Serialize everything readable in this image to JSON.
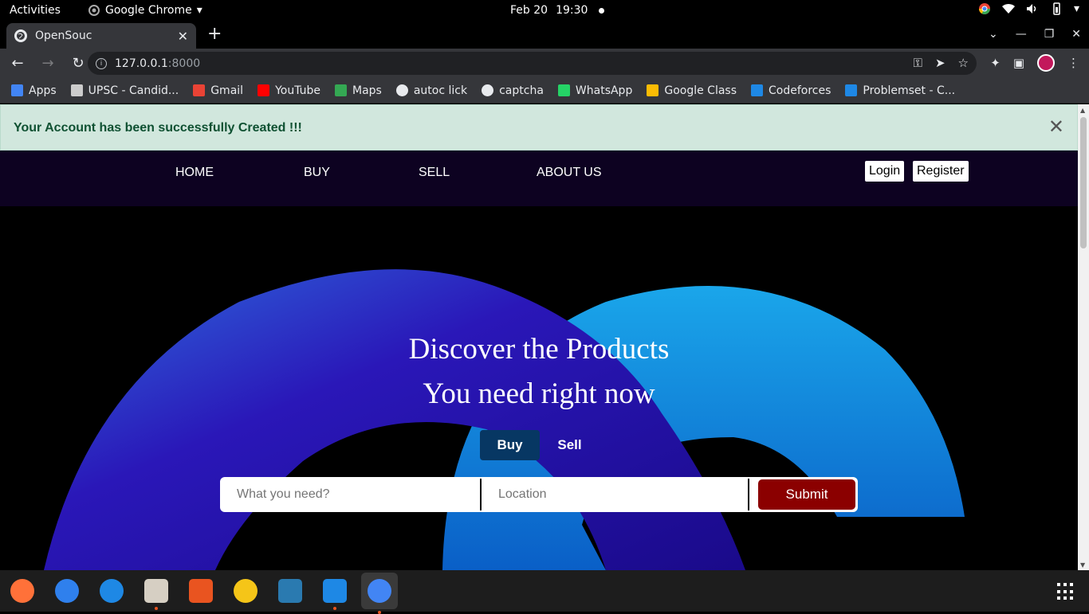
{
  "system": {
    "activities": "Activities",
    "app_name": "Google Chrome",
    "date": "Feb 20",
    "time": "19:30"
  },
  "browser": {
    "tab_title": "OpenSouc",
    "url_host": "127.0.0.1",
    "url_port": ":8000",
    "bookmarks": [
      {
        "label": "Apps",
        "icon": "apps-grid-icon",
        "color": "#4285f4"
      },
      {
        "label": "UPSC - Candid...",
        "icon": "upsc-icon",
        "color": "#cccccc"
      },
      {
        "label": "Gmail",
        "icon": "gmail-icon",
        "color": "#ea4335"
      },
      {
        "label": "YouTube",
        "icon": "youtube-icon",
        "color": "#ff0000"
      },
      {
        "label": "Maps",
        "icon": "maps-icon",
        "color": "#34a853"
      },
      {
        "label": "autoc lick",
        "icon": "globe-icon",
        "color": "#e8eaed"
      },
      {
        "label": "captcha",
        "icon": "globe-icon",
        "color": "#e8eaed"
      },
      {
        "label": "WhatsApp",
        "icon": "whatsapp-icon",
        "color": "#25d366"
      },
      {
        "label": "Google Class",
        "icon": "classroom-icon",
        "color": "#fbbc04"
      },
      {
        "label": "Codeforces",
        "icon": "codeforces-icon",
        "color": "#1e88e5"
      },
      {
        "label": "Problemset - C...",
        "icon": "codeforces-icon",
        "color": "#1e88e5"
      }
    ]
  },
  "page": {
    "alert_text": "Your Account has been successfully Created !!!",
    "nav": {
      "home": "HOME",
      "buy": "BUY",
      "sell": "SELL",
      "about": "ABOUT US",
      "login": "Login",
      "register": "Register"
    },
    "hero": {
      "line1": "Discover the Products",
      "line2": "You need right now"
    },
    "toggle": {
      "buy": "Buy",
      "sell": "Sell",
      "active": "Buy"
    },
    "search": {
      "what_placeholder": "What you need?",
      "location_placeholder": "Location",
      "submit": "Submit"
    }
  },
  "dock": [
    {
      "name": "firefox-icon",
      "color": "#ff7139"
    },
    {
      "name": "thunderbird-icon",
      "color": "#2f80ed"
    },
    {
      "name": "help-icon",
      "color": "#1e88e5"
    },
    {
      "name": "files-icon",
      "color": "#d6cfc3"
    },
    {
      "name": "software-center-icon",
      "color": "#e95420"
    },
    {
      "name": "rhythmbox-icon",
      "color": "#f5c518"
    },
    {
      "name": "libreoffice-writer-icon",
      "color": "#2a7ab0"
    },
    {
      "name": "vscode-icon",
      "color": "#1e88e5"
    },
    {
      "name": "chrome-icon",
      "color": "#4285f4"
    }
  ]
}
